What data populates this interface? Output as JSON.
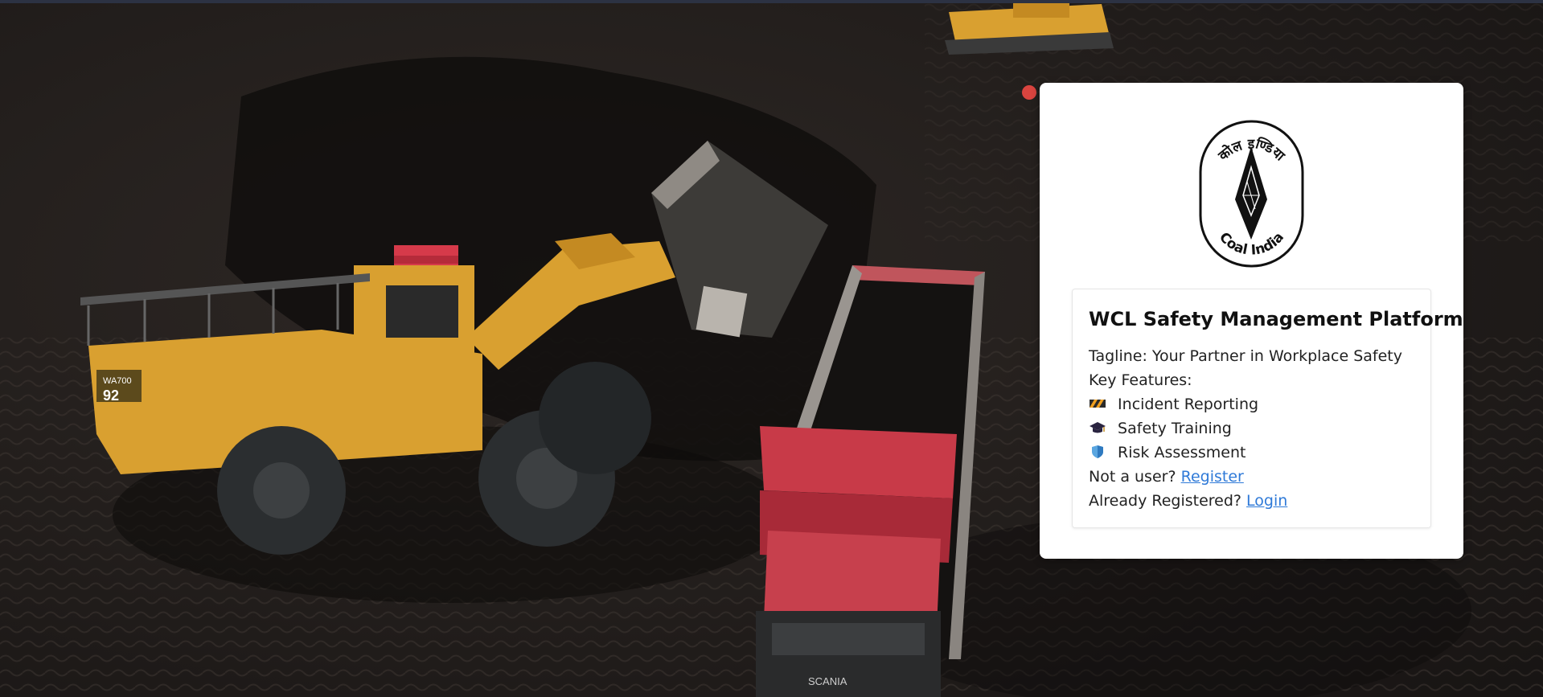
{
  "page": {
    "title": "WCL Safety Management Platform",
    "tagline_label": "Tagline:",
    "tagline": "Your Partner in Workplace Safety",
    "features_label": "Key Features:",
    "features": [
      {
        "icon": "warning-stripes-icon",
        "label": "Incident Reporting"
      },
      {
        "icon": "graduation-cap-icon",
        "label": "Safety Training"
      },
      {
        "icon": "shield-icon",
        "label": "Risk Assessment"
      }
    ],
    "register_prompt": "Not a user?",
    "register_link": "Register",
    "login_prompt": "Already Registered?",
    "login_link": "Login"
  },
  "logo": {
    "hindi_text": "कोल इण्डिया",
    "english_text": "Coal India"
  },
  "background": {
    "loader_model": "WA700",
    "loader_number": "92",
    "truck_brand": "SCANIA"
  },
  "colors": {
    "link": "#2f7ad8",
    "card": "#ffffff",
    "loader": "#d9a030",
    "truck": "#c83a48",
    "ground": "#2a2522"
  }
}
